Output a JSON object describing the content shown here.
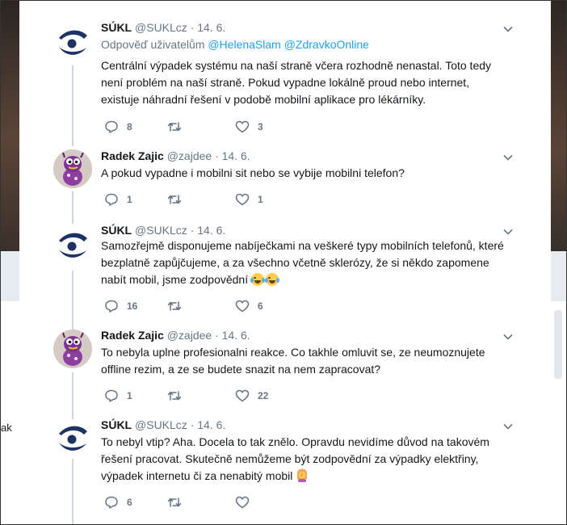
{
  "background": {
    "left_fragment_text": "ak"
  },
  "colors": {
    "link_blue": "#1da1f2",
    "muted_grey": "#657786",
    "text": "#14171a",
    "thread_line": "#ccd6dd",
    "sukl_navy": "#1e3264"
  },
  "tweets": [
    {
      "author": "SÚKL",
      "handle": "@SUKLcz",
      "sep": "·",
      "date": "14. 6.",
      "avatar_icon": "sukl-logo",
      "reply_prefix": "Odpověď uživatelům",
      "reply_mentions": [
        "@HelenaSlam",
        "@ZdravkoOnline"
      ],
      "lines": [
        "Centrální výpadek systému na naší straně včera rozhodně nenastal. Toto tedy",
        "není problém na naší straně. Pokud vypadne lokálně proud nebo internet,",
        "existuje náhradní řešení v podobě mobilní aplikace pro lékárníky."
      ],
      "replies": "8",
      "retweets": "",
      "likes": "3"
    },
    {
      "author": "Radek Zajic",
      "handle": "@zajdee",
      "sep": "·",
      "date": "14. 6.",
      "avatar_icon": "plush-toy-avatar",
      "lines": [
        "A pokud vypadne i mobilni sit nebo se vybije mobilni telefon?"
      ],
      "replies": "1",
      "retweets": "",
      "likes": "1"
    },
    {
      "author": "SÚKL",
      "handle": "@SUKLcz",
      "sep": "·",
      "date": "14. 6.",
      "avatar_icon": "sukl-logo",
      "lines": [
        "Samozřejmě disponujeme nabíječkami na veškeré typy mobilních telefonů, které",
        "bezplatně zapůjčujeme, a za všechno včetně sklerózy, že si někdo zapomene",
        "nabít mobil, jsme zodpovědní"
      ],
      "trailing_emoji": [
        "face-with-tears-of-joy",
        "face-with-tears-of-joy"
      ],
      "replies": "16",
      "retweets": "",
      "likes": "6"
    },
    {
      "author": "Radek Zajic",
      "handle": "@zajdee",
      "sep": "·",
      "date": "14. 6.",
      "avatar_icon": "plush-toy-avatar",
      "lines": [
        "To nebyla uplne profesionalni reakce. Co takhle omluvit se, ze neumoznujete",
        "offline rezim, a ze se budete snazit na nem zapracovat?"
      ],
      "replies": "1",
      "retweets": "",
      "likes": "22"
    },
    {
      "author": "SÚKL",
      "handle": "@SUKLcz",
      "sep": "·",
      "date": "14. 6.",
      "avatar_icon": "sukl-logo",
      "lines": [
        "To nebyl vtip? Aha. Docela to tak znělo. Opravdu nevidíme důvod na takovém",
        "řešení pracovat. Skutečně nemůžeme být zodpovědní za výpadky elektřiny,",
        "výpadek internetu či za nenabitý mobil"
      ],
      "trailing_emoji": [
        "woman-facepalming"
      ],
      "replies": "6",
      "retweets": "",
      "likes": ""
    }
  ]
}
